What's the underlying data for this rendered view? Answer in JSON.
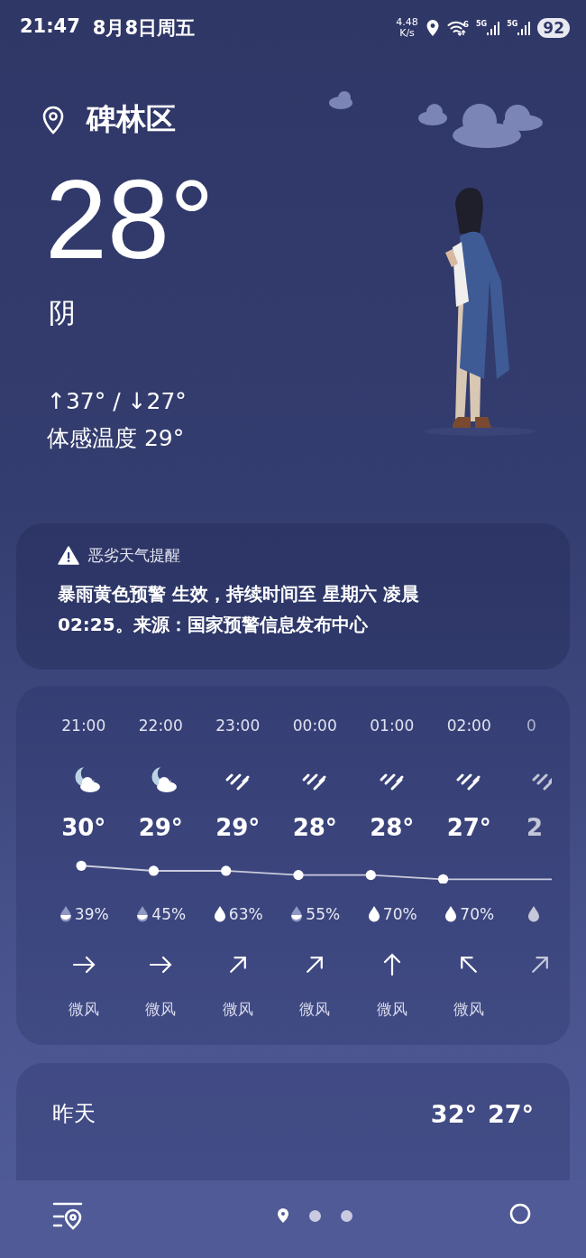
{
  "status_bar": {
    "time": "21:47",
    "date": "8月8日周五",
    "net_speed": "4.48",
    "net_unit": "K/s",
    "wifi_badge": "6",
    "signals": [
      "5G",
      "5G"
    ],
    "battery": "92"
  },
  "location": {
    "name": "碑林区"
  },
  "current": {
    "temp": "28°",
    "condition": "阴",
    "high_low": "↑37° / ↓27°",
    "feels_like": "体感温度 29°"
  },
  "alert": {
    "title": "恶劣天气提醒",
    "text": "暴雨黄色预警 生效，持续时间至 星期六 凌晨 02:25。来源：国家预警信息发布中心"
  },
  "hourly": [
    {
      "time": "21:00",
      "kind": "moon-cloud",
      "temp": "30°",
      "precip": "39%",
      "wind": "微风"
    },
    {
      "time": "22:00",
      "kind": "moon-cloud",
      "temp": "29°",
      "precip": "45%",
      "wind": "微风"
    },
    {
      "time": "23:00",
      "kind": "rain",
      "temp": "29°",
      "precip": "63%",
      "wind": "微风"
    },
    {
      "time": "00:00",
      "kind": "rain",
      "temp": "28°",
      "precip": "55%",
      "wind": "微风"
    },
    {
      "time": "01:00",
      "kind": "rain",
      "temp": "28°",
      "precip": "70%",
      "wind": "微风"
    },
    {
      "time": "02:00",
      "kind": "rain",
      "temp": "27°",
      "precip": "70%",
      "wind": "微风"
    },
    {
      "time": "0",
      "kind": "rain",
      "temp": "2"
    }
  ],
  "daily": [
    {
      "day": "昨天",
      "high": "32°",
      "low": "27°"
    }
  ],
  "bottom_bar": {
    "pages": [
      {
        "kind": "location",
        "selected": true
      },
      {
        "kind": "dot",
        "selected": false
      },
      {
        "kind": "dot",
        "selected": false
      }
    ]
  }
}
